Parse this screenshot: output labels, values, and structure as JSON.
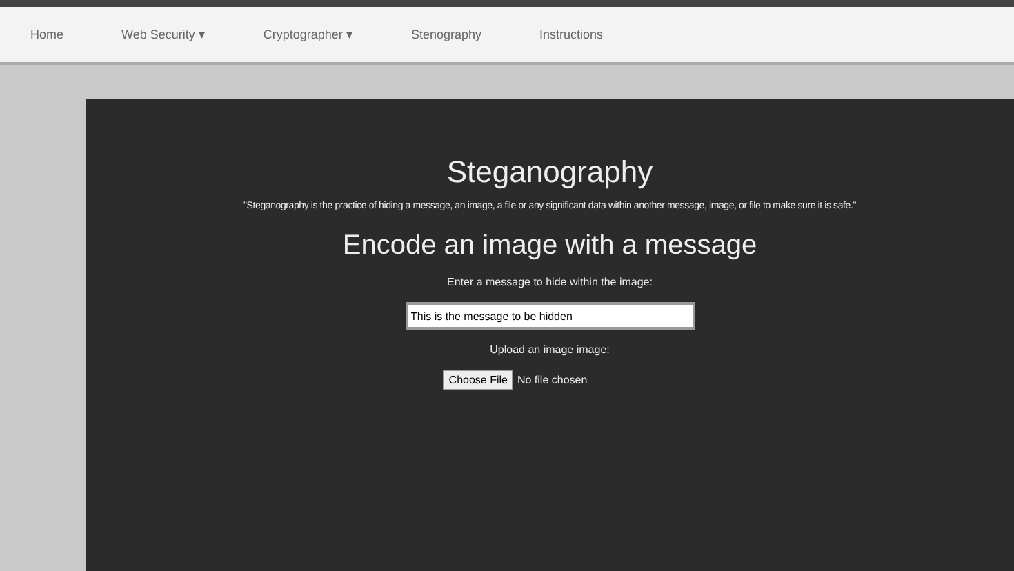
{
  "nav": {
    "items": [
      {
        "label": "Home",
        "dropdown": false
      },
      {
        "label": "Web Security",
        "dropdown": true
      },
      {
        "label": "Cryptographer",
        "dropdown": true
      },
      {
        "label": "Stenography",
        "dropdown": false
      },
      {
        "label": "Instructions",
        "dropdown": false
      }
    ],
    "caret": "▾"
  },
  "panel": {
    "title": "Steganography",
    "quote": "\"Steganography is the practice of hiding a message, an image, a file or any significant data within another message, image, or file to make sure it is safe.\"",
    "form_title": "Encode an image with a message",
    "message_label": "Enter a message to hide within the image:",
    "message_value": "This is the message to be hidden",
    "upload_label": "Upload an image image:",
    "file_button": "Choose File",
    "file_status": "No file chosen"
  }
}
